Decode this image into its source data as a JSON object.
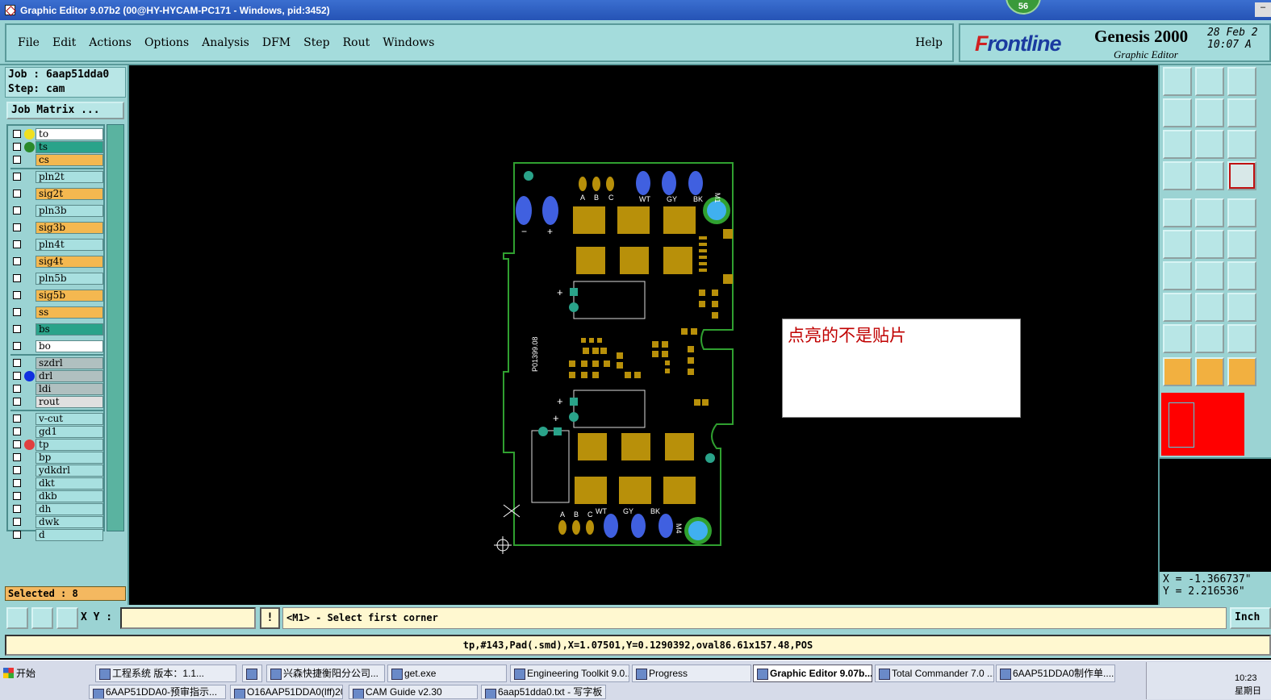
{
  "window": {
    "title": "Graphic Editor 9.07b2 (00@HY-HYCAM-PC171 - Windows, pid:3452)",
    "badge": "56"
  },
  "menu": {
    "items": [
      {
        "label": "File"
      },
      {
        "label": "Edit"
      },
      {
        "label": "Actions"
      },
      {
        "label": "Options"
      },
      {
        "label": "Analysis"
      },
      {
        "label": "DFM"
      },
      {
        "label": "Step"
      },
      {
        "label": "Rout"
      },
      {
        "label": "Windows"
      }
    ],
    "help": "Help"
  },
  "brand": {
    "logo_f": "F",
    "logo_rest": "rontline",
    "product": "Genesis 2000",
    "module": "Graphic Editor",
    "date_line1": "28 Feb 2",
    "date_line2": "10:07 A"
  },
  "job": {
    "job": "Job : 6aap51dda0",
    "step": "Step: cam",
    "matrix_button": "Job Matrix ..."
  },
  "layers": [
    {
      "name": "to",
      "color": "#ffffff",
      "dot": "#f0e020"
    },
    {
      "name": "ts",
      "color": "#2aa38a",
      "dot": "#2a8a2a"
    },
    {
      "name": "cs",
      "color": "#f4b850",
      "dot": ""
    },
    {
      "name": "pln2t",
      "color": "#a8e0e0",
      "dot": ""
    },
    {
      "name": "sig2t",
      "color": "#f4b850",
      "dot": ""
    },
    {
      "name": "pln3b",
      "color": "#a8e0e0",
      "dot": ""
    },
    {
      "name": "sig3b",
      "color": "#f4b850",
      "dot": ""
    },
    {
      "name": "pln4t",
      "color": "#a8e0e0",
      "dot": ""
    },
    {
      "name": "sig4t",
      "color": "#f4b850",
      "dot": ""
    },
    {
      "name": "pln5b",
      "color": "#a8e0e0",
      "dot": ""
    },
    {
      "name": "sig5b",
      "color": "#f4b850",
      "dot": ""
    },
    {
      "name": "ss",
      "color": "#f4b850",
      "dot": ""
    },
    {
      "name": "bs",
      "color": "#2aa38a",
      "dot": ""
    },
    {
      "name": "bo",
      "color": "#ffffff",
      "dot": ""
    },
    {
      "name": "szdrl",
      "color": "#b0c0c0",
      "dot": ""
    },
    {
      "name": "drl",
      "color": "#b0c0c0",
      "dot": "#1030e0"
    },
    {
      "name": "ldi",
      "color": "#b0c0c0",
      "dot": ""
    },
    {
      "name": "rout",
      "color": "#e0e0e0",
      "dot": ""
    },
    {
      "name": "v-cut",
      "color": "#a8e0e0",
      "dot": ""
    },
    {
      "name": "gd1",
      "color": "#a8e0e0",
      "dot": ""
    },
    {
      "name": "tp",
      "color": "#a8e0e0",
      "dot": "#e04040"
    },
    {
      "name": "bp",
      "color": "#a8e0e0",
      "dot": ""
    },
    {
      "name": "ydkdrl",
      "color": "#a8e0e0",
      "dot": ""
    },
    {
      "name": "dkt",
      "color": "#a8e0e0",
      "dot": ""
    },
    {
      "name": "dkb",
      "color": "#a8e0e0",
      "dot": ""
    },
    {
      "name": "dh",
      "color": "#a8e0e0",
      "dot": ""
    },
    {
      "name": "dwk",
      "color": "#a8e0e0",
      "dot": ""
    },
    {
      "name": "d",
      "color": "#a8e0e0",
      "dot": ""
    }
  ],
  "selected": "Selected : 8",
  "board": {
    "top_labels": [
      "A",
      "B",
      "C",
      "WT",
      "GY",
      "BK"
    ],
    "bottom_labels": [
      "A",
      "B",
      "C",
      "WT",
      "GY",
      "BK"
    ],
    "polarity": [
      "−",
      "+"
    ],
    "part_number": "P01399.08",
    "mark_top": "M1",
    "mark_bottom": "M4",
    "plus_marks": [
      "+",
      "+",
      "+"
    ]
  },
  "note": "点亮的不是贴片",
  "coords": {
    "x": "X = -1.366737\"",
    "y": "Y = 2.216536\""
  },
  "status": {
    "xy_label": "X Y :",
    "xy_value": "",
    "excl": "!",
    "prompt": "<M1> - Select first corner",
    "unit": "Inch"
  },
  "info": "tp,#143,Pad(.smd),X=1.07501,Y=0.1290392,oval86.61x157.48,POS",
  "taskbar": {
    "start": "开始",
    "row1": [
      "工程系统  版本：1.1...",
      "",
      "兴森快捷衡阳分公司...",
      "get.exe",
      "Engineering Toolkit 9.0...",
      "Progress",
      "Graphic Editor 9.07b...",
      "Total Commander 7.0 ...",
      "6AAP51DDA0制作单...."
    ],
    "row2": [
      "6AAP51DDA0-预审指示...",
      "O16AAP51DDA0(lff)201...",
      "CAM  Guide v2.30",
      "6aap51dda0.txt - 写字板"
    ],
    "clock_time": "10:23",
    "clock_day": "星期日"
  },
  "colors": {
    "panel": "#9bd3d3",
    "copper": "#b8900a",
    "board_outline": "#30a030",
    "hole_blue": "#4060e0",
    "accent_red": "#c00000"
  }
}
